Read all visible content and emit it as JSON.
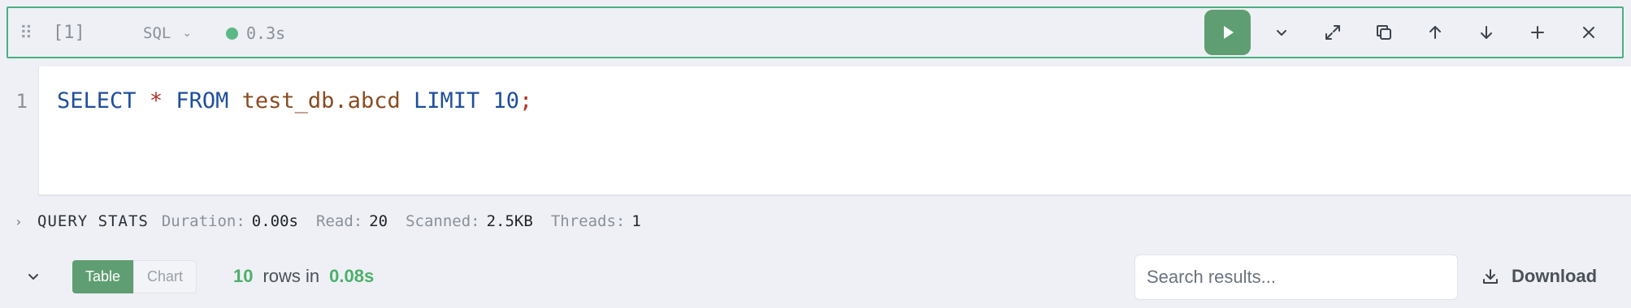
{
  "cell": {
    "index_label": "[1]",
    "language": "SQL",
    "status_time": "0.3s",
    "status_color": "#5cb887"
  },
  "toolbar": {
    "run_icon": "play-icon",
    "buttons": [
      "chevron-down-icon",
      "expand-icon",
      "copy-icon",
      "arrow-up-icon",
      "arrow-down-icon",
      "plus-icon",
      "close-icon"
    ]
  },
  "editor": {
    "line_number": "1",
    "tokens": {
      "select": "SELECT",
      "star": "*",
      "from": "FROM",
      "table": "test_db.abcd",
      "limit": "LIMIT",
      "num": "10",
      "semicolon": ";"
    }
  },
  "stats": {
    "title": "QUERY STATS",
    "duration_label": "Duration:",
    "duration_value": "0.00s",
    "read_label": "Read:",
    "read_value": "20",
    "scanned_label": "Scanned:",
    "scanned_value": "2.5KB",
    "threads_label": "Threads:",
    "threads_value": "1"
  },
  "results": {
    "tab_table": "Table",
    "tab_chart": "Chart",
    "rows_count": "10",
    "rows_text": "rows in",
    "rows_time": "0.08s",
    "search_placeholder": "Search results...",
    "download_label": "Download"
  },
  "colors": {
    "accent_green": "#5f9e72",
    "header_border": "#4caf83"
  }
}
